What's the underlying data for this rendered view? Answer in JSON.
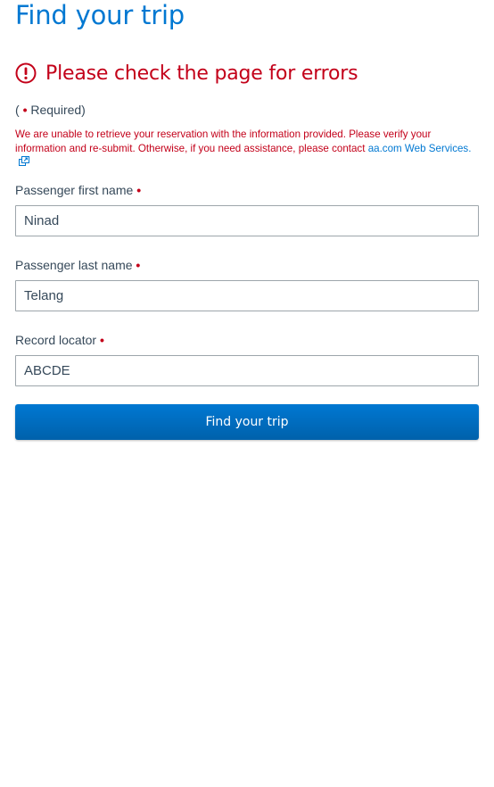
{
  "page": {
    "title": "Find your trip"
  },
  "error": {
    "heading": "Please check the page for errors",
    "message_before_link": "We are unable to retrieve your reservation with the information provided. Please verify your information and re-submit. Otherwise, if you need assistance, please contact ",
    "link_text": "aa.com Web Services.",
    "icon": "alert-circle-icon",
    "color": "#c30019"
  },
  "required_note": {
    "open": "(",
    "dot": "•",
    "text": " Required)"
  },
  "form": {
    "first_name": {
      "label": "Passenger first name",
      "required_dot": "•",
      "value": "Ninad"
    },
    "last_name": {
      "label": "Passenger last name",
      "required_dot": "•",
      "value": "Telang"
    },
    "record_locator": {
      "label": "Record locator",
      "required_dot": "•",
      "value": "ABCDE"
    },
    "submit_label": "Find your trip"
  },
  "colors": {
    "brand_blue": "#0078d2",
    "error_red": "#c30019",
    "text": "#36495a",
    "input_border": "#9da6ab"
  }
}
